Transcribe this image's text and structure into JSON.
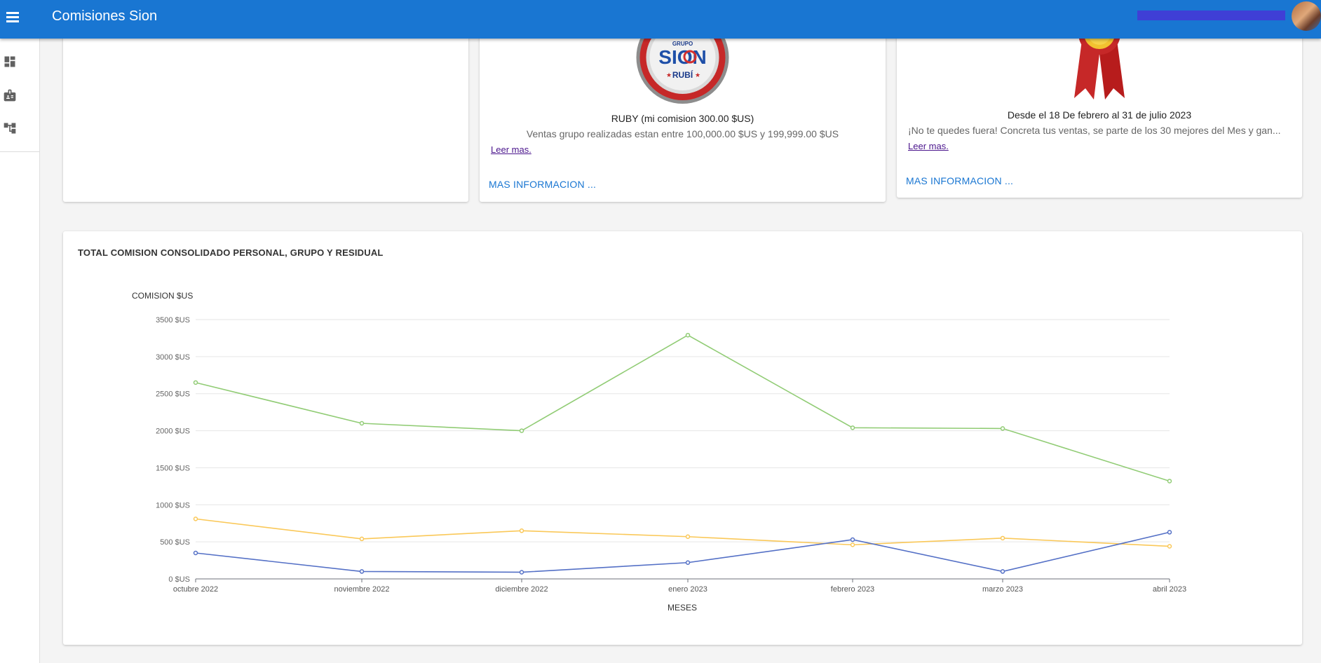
{
  "app": {
    "title": "Comisiones Sion"
  },
  "sidebar": {
    "items": [
      {
        "icon": "dashboard-icon"
      },
      {
        "icon": "badge-icon"
      },
      {
        "icon": "account-tree-icon"
      }
    ]
  },
  "cards": [
    {},
    {
      "badge_text_top": "GRUPO",
      "badge_text_main": "SION",
      "badge_text_bottom": "RUBÍ",
      "title": "RUBY (mi comision 300.00 $US)",
      "text": "Ventas grupo realizadas estan entre 100,000.00 $US y 199,999.00 $US",
      "link": "Leer mas.",
      "more": "MAS INFORMACION ..."
    },
    {
      "title": "Desde el 18 De febrero al 31 de julio 2023",
      "text": "¡No te quedes fuera! Concreta tus ventas, se parte de los 30 mejores del Mes y gan...",
      "link": "Leer mas.",
      "more": "MAS INFORMACION ..."
    }
  ],
  "chart_data": {
    "type": "line",
    "title": "TOTAL COMISION CONSOLIDADO PERSONAL, GRUPO Y RESIDUAL",
    "ylabel": "COMISION $US",
    "xlabel": "MESES",
    "categories": [
      "octubre 2022",
      "noviembre 2022",
      "diciembre 2022",
      "enero 2023",
      "febrero 2023",
      "marzo 2023",
      "abril 2023"
    ],
    "ylim": [
      0,
      3500
    ],
    "yticks": [
      0,
      500,
      1000,
      1500,
      2000,
      2500,
      3000,
      3500
    ],
    "ytick_labels": [
      "0 $US",
      "500 $US",
      "1000 $US",
      "1500 $US",
      "2000 $US",
      "2500 $US",
      "3000 $US",
      "3500 $US"
    ],
    "grid": true,
    "series": [
      {
        "color": "#91cc75",
        "values": [
          2650,
          2100,
          2000,
          3290,
          2040,
          2030,
          1320
        ]
      },
      {
        "color": "#fac858",
        "values": [
          810,
          540,
          650,
          570,
          460,
          550,
          440
        ]
      },
      {
        "color": "#5470c6",
        "values": [
          350,
          100,
          90,
          220,
          530,
          100,
          630
        ]
      }
    ]
  }
}
